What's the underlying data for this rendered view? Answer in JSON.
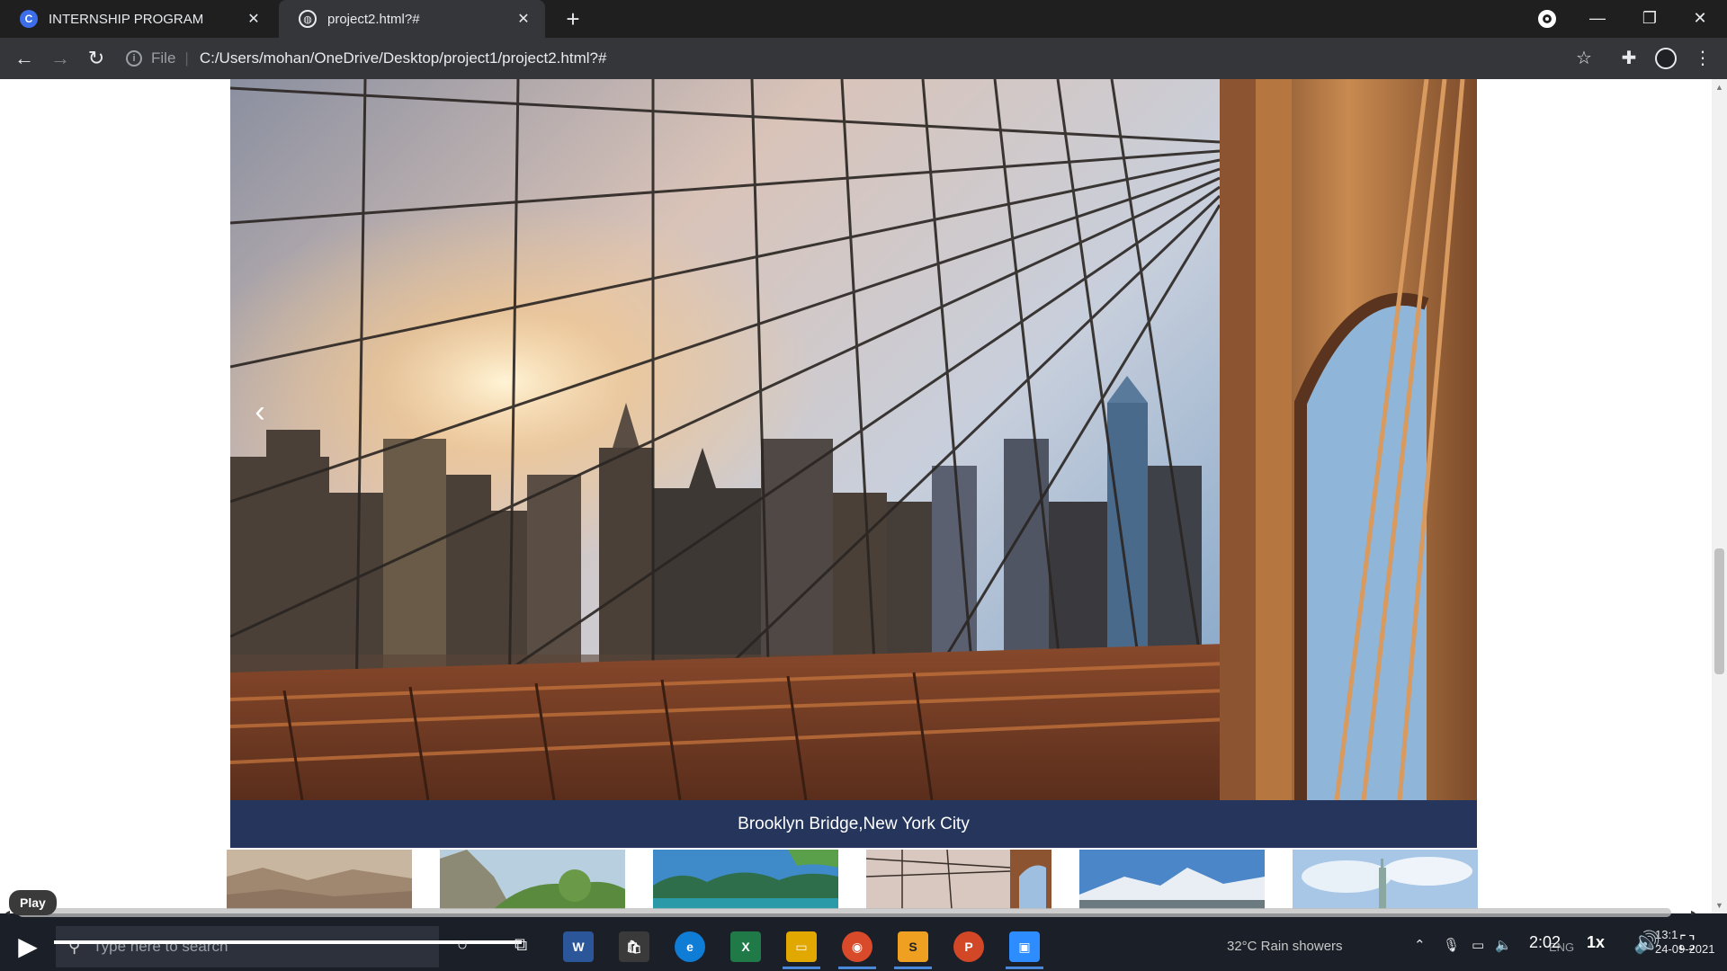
{
  "browser": {
    "tabs": [
      {
        "title": "INTERNSHIP PROGRAM",
        "favicon": "c-logo-icon",
        "active": false
      },
      {
        "title": "project2.html?#",
        "favicon": "globe-icon",
        "active": true
      }
    ],
    "new_tab_label": "+",
    "address": {
      "scheme_label": "File",
      "url": "C:/Users/mohan/OneDrive/Desktop/project1/project2.html?#"
    }
  },
  "carousel": {
    "caption": "Brooklyn Bridge,New York City",
    "prev_label": "‹",
    "thumbnails": [
      {
        "name": "rocky-canyon-thumb"
      },
      {
        "name": "green-valley-thumb"
      },
      {
        "name": "tropical-islands-thumb"
      },
      {
        "name": "brooklyn-bridge-thumb"
      },
      {
        "name": "snowy-mountains-thumb"
      },
      {
        "name": "statue-of-liberty-thumb"
      }
    ]
  },
  "video_player": {
    "tooltip": "Play",
    "time": "2:02",
    "speed": "1x"
  },
  "taskbar": {
    "search_placeholder": "Type here to search",
    "weather": "32°C  Rain showers",
    "language": "ENG",
    "clock_time": "13:1",
    "clock_date": "24-09-2021"
  },
  "colors": {
    "caption_bar": "#26355c",
    "tab_bar": "#1f1f1f",
    "toolbar": "#35363a",
    "taskbar": "#1b1f27"
  }
}
